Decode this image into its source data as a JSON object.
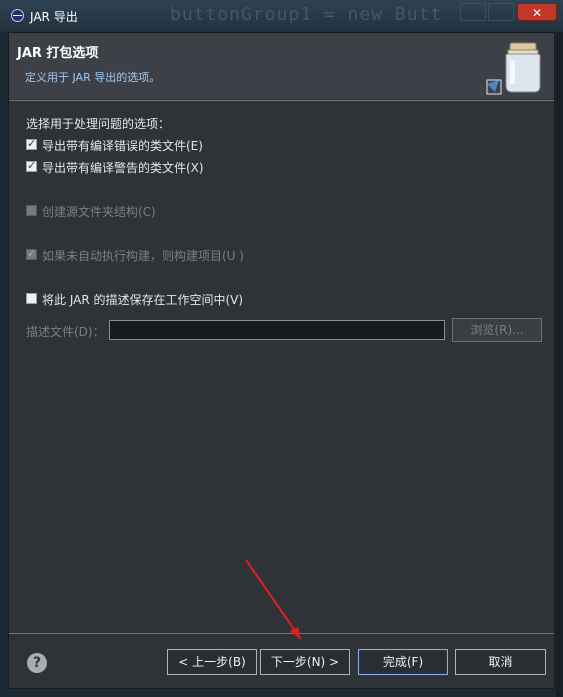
{
  "window": {
    "title": "JAR 导出",
    "bg_code": "buttonGroup1 = new Butt",
    "close_label": "✕"
  },
  "header": {
    "title": "JAR 打包选项",
    "description": "定义用于 JAR 导出的选项。"
  },
  "options": {
    "problems_label": "选择用于处理问题的选项：",
    "export_errors": {
      "label": "导出带有编译错误的类文件(E)",
      "checked": true,
      "enabled": true
    },
    "export_warnings": {
      "label": "导出带有编译警告的类文件(X)",
      "checked": true,
      "enabled": true
    },
    "create_source_folder": {
      "label": "创建源文件夹结构(C)",
      "checked": false,
      "enabled": false
    },
    "build_if_needed": {
      "label": "如果未自动执行构建，则构建项目(U )",
      "checked": true,
      "enabled": false
    },
    "save_description": {
      "label": "将此 JAR 的描述保存在工作空间中(V)",
      "checked": false,
      "enabled": true
    }
  },
  "description_file": {
    "label": "描述文件(D)：",
    "value": "",
    "browse_label": "浏览(R)..."
  },
  "buttons": {
    "help": "?",
    "back": "< 上一步(B)",
    "next": "下一步(N) >",
    "finish": "完成(F)",
    "cancel": "取消"
  },
  "colors": {
    "accent": "#7fb4e6",
    "annotation_arrow": "#e02020"
  }
}
